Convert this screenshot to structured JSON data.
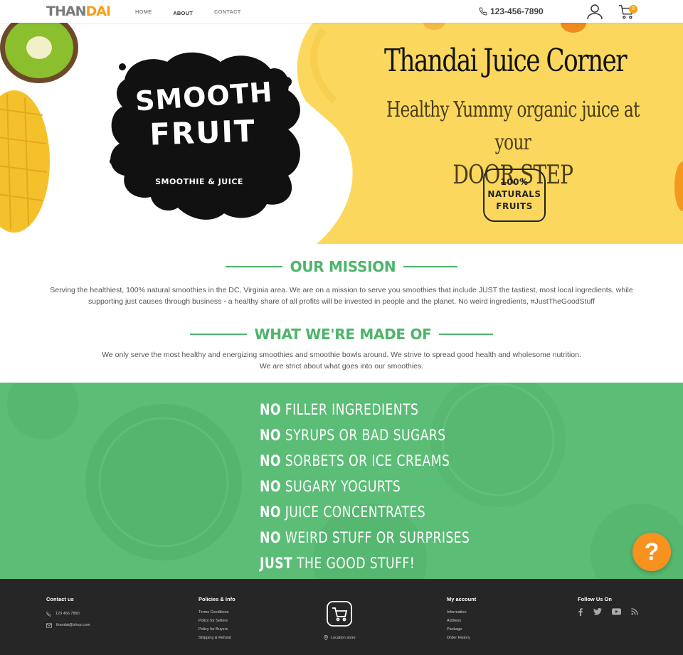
{
  "header": {
    "logo_part1": "THAN",
    "logo_part2": "DAI",
    "nav": [
      "HOME",
      "ABOUT",
      "CONTACT"
    ],
    "phone": "123-456-7890",
    "cart_count": "0"
  },
  "hero": {
    "title": "Thandai Juice Corner",
    "subtitle_line1": "Healthy Yummy organic juice at your",
    "subtitle_line2": "DOOR STEP",
    "splash_line1": "SMOOTH",
    "splash_line2": "FRUIT",
    "splash_line3": "SMOOTHIE & JUICE",
    "badge_line1": "100%",
    "badge_line2": "NATURALS",
    "badge_line3": "FRUITS"
  },
  "mission": {
    "heading": "OUR MISSION",
    "text": "Serving the healthiest, 100% natural smoothies in the DC, Virginia area. We are on a mission to serve you smoothies that include JUST the tastiest, most local ingredients, while supporting just causes through business - a healthy share of all profits will be invested in people and the planet. No weird ingredients, #JustTheGoodStuff"
  },
  "made_of": {
    "heading": "WHAT WE'RE MADE OF",
    "text_line1": "We only serve the most healthy and energizing smoothies and smoothie bowls around. We strive to spread good health and wholesome nutrition.",
    "text_line2": "We are strict about what goes into our smoothies."
  },
  "band": {
    "items": [
      {
        "prefix": "NO",
        "rest": "FILLER INGREDIENTS"
      },
      {
        "prefix": "NO",
        "rest": "SYRUPS OR BAD SUGARS"
      },
      {
        "prefix": "NO",
        "rest": "SORBETS OR ICE CREAMS"
      },
      {
        "prefix": "NO",
        "rest": "SUGARY YOGURTS"
      },
      {
        "prefix": "NO",
        "rest": "JUICE CONCENTRATES"
      },
      {
        "prefix": "NO",
        "rest": "WEIRD STUFF OR SURPRISES"
      },
      {
        "prefix": "JUST",
        "rest": "THE GOOD STUFF!"
      }
    ]
  },
  "help_button": "?",
  "footer": {
    "contact": {
      "heading": "Contact us",
      "phone": "123 456 7890",
      "email": "thandai@shop.com"
    },
    "policies": {
      "heading": "Policies & Info",
      "items": [
        "Terms Conditions",
        "Policy for Sellers",
        "Policy for Buyers",
        "Shipping & Refund"
      ]
    },
    "store": {
      "label": "Location store"
    },
    "account": {
      "heading": "My account",
      "items": [
        "Information",
        "Address",
        "Package",
        "Order History"
      ]
    },
    "follow": {
      "heading": "Follow Us On"
    }
  },
  "colors": {
    "accent_green": "#4db56a",
    "band_green": "#5bbd76",
    "orange": "#f5a21a",
    "footer_bg": "#262626",
    "hero_yellow": "#fbd85d"
  },
  "icons": [
    "phone-icon",
    "user-icon",
    "cart-icon",
    "map-pin-icon",
    "mail-icon",
    "facebook-icon",
    "twitter-icon",
    "youtube-icon",
    "rss-icon",
    "help-icon"
  ]
}
